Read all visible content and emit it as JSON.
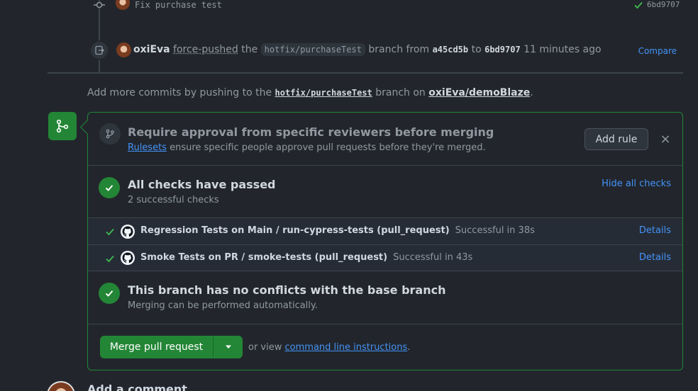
{
  "timeline": {
    "commit": {
      "message": "Fix purchase test",
      "sha": "6bd9707"
    },
    "push": {
      "user": "oxiEva",
      "action": "force-pushed",
      "the": "the",
      "branch": "hotfix/purchaseTest",
      "branch_from": "branch from",
      "from_sha": "a45cd5b",
      "to": "to",
      "to_sha": "6bd9707",
      "time": "11 minutes ago",
      "compare_label": "Compare"
    }
  },
  "hint": {
    "prefix": "Add more commits by pushing to the",
    "branch": "hotfix/purchaseTest",
    "middle": "branch on",
    "repo": "oxiEva/demoBlaze",
    "suffix": "."
  },
  "rule": {
    "title": "Require approval from specific reviewers before merging",
    "link": "Rulesets",
    "desc": "ensure specific people approve pull requests before they're merged.",
    "add_label": "Add rule",
    "close_glyph": "×"
  },
  "checks": {
    "title": "All checks have passed",
    "subtitle": "2 successful checks",
    "hide_label": "Hide all checks",
    "items": [
      {
        "name": "Regression Tests on Main / run-cypress-tests (pull_request)",
        "status": "Successful in 38s",
        "details": "Details"
      },
      {
        "name": "Smoke Tests on PR / smoke-tests (pull_request)",
        "status": "Successful in 43s",
        "details": "Details"
      }
    ]
  },
  "conflicts": {
    "title": "This branch has no conflicts with the base branch",
    "subtitle": "Merging can be performed automatically."
  },
  "merge": {
    "button_label": "Merge pull request",
    "or_view": "or view",
    "cli_link": "command line instructions",
    "period": "."
  },
  "comment": {
    "title": "Add a comment"
  },
  "colors": {
    "success": "#238636",
    "link": "#4493f8",
    "background": "#22262c"
  }
}
